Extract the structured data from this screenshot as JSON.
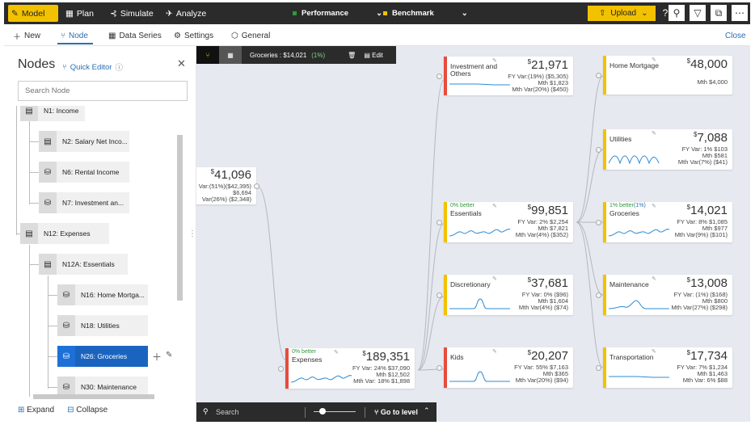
{
  "topbar": {
    "model": "Model",
    "plan": "Plan",
    "simulate": "Simulate",
    "analyze": "Analyze",
    "performance": "Performance",
    "benchmark": "Benchmark",
    "upload": "Upload",
    "perf_color": "#2e9a3a",
    "bench_color": "#f2c200"
  },
  "subbar": {
    "new": "New",
    "node": "Node",
    "data_series": "Data Series",
    "settings": "Settings",
    "general": "General",
    "close": "Close"
  },
  "panel": {
    "title": "Nodes",
    "quick_editor": "Quick Editor",
    "search_placeholder": "Search Node",
    "expand": "Expand",
    "collapse": "Collapse",
    "nodes": [
      {
        "label": "N1: Income"
      },
      {
        "label": "N2: Salary Net Inco..."
      },
      {
        "label": "N6: Rental Income"
      },
      {
        "label": "N7: Investment an..."
      },
      {
        "label": "N12: Expenses"
      },
      {
        "label": "N12A: Essentials"
      },
      {
        "label": "N16: Home Mortga..."
      },
      {
        "label": "N18: Utilities"
      },
      {
        "label": "N26: Groceries"
      },
      {
        "label": "N30: Maintenance"
      }
    ]
  },
  "canvas": {
    "toolbar_label": "Groceries : $14,021",
    "toolbar_change": "(1%)",
    "edit": "Edit",
    "search": "Search",
    "go_to_level": "Go to level",
    "income_card": {
      "value": "41,096",
      "fy": "Var:(51%)($42,395)",
      "mth": "$6,694",
      "mth_var": "Var(26%)  ($2,348)"
    },
    "cards": {
      "investment": {
        "name": "Investment and Others",
        "value": "21,971",
        "r1": "FY Var:(19%)  ($5,305)",
        "r2": "Mth          $1,823",
        "r3": "Mth Var(20%)    ($450)",
        "color": "#e74c3c"
      },
      "essentials": {
        "name": "Essentials",
        "value": "99,851",
        "better": "0% better",
        "r1": "FY Var:    2%   $2,254",
        "r2": "Mth              $7,821",
        "r3": "Mth Var(4%)      ($352)",
        "color": "#f2c200"
      },
      "discretionary": {
        "name": "Discretionary",
        "value": "37,681",
        "r1": "FY Var:    0%     ($96)",
        "r2": "Mth              $1,604",
        "r3": "Mth Var(4%)       ($74)",
        "color": "#f2c200"
      },
      "kids": {
        "name": "Kids",
        "value": "20,207",
        "r1": "FY Var:   55%   $7,163",
        "r2": "Mth                $365",
        "r3": "Mth Var(20%)      ($94)",
        "color": "#e74c3c"
      },
      "expenses": {
        "name": "Expenses",
        "value": "189,351",
        "better": "0% better",
        "r1": "FY Var:  24%  $37,090",
        "r2": "Mth          $12,502",
        "r3": "Mth Var: 18%   $1,898",
        "color": "#e74c3c"
      },
      "mortgage": {
        "name": "Home Mortgage",
        "value": "48,000",
        "r1": "",
        "r2": "Mth             $4,000",
        "r3": "",
        "color": "#f2c200"
      },
      "utilities": {
        "name": "Utilities",
        "value": "7,088",
        "r1": "FY Var:    1%     $103",
        "r2": "Mth                $581",
        "r3": "Mth Var(7%)       ($41)",
        "color": "#f2c200"
      },
      "groceries": {
        "name": "Groceries",
        "value": "14,021",
        "better": "1% better",
        "change": "(1%)",
        "r1": "FY Var:    8%   $1,085",
        "r2": "Mth                $977",
        "r3": "Mth Var(9%)     ($101)",
        "color": "#f2c200"
      },
      "maintenance": {
        "name": "Maintenance",
        "value": "13,008",
        "r1": "FY Var:  (1%)    ($168)",
        "r2": "Mth                $800",
        "r3": "Mth Var(27%)    ($298)",
        "color": "#f2c200"
      },
      "transportation": {
        "name": "Transportation",
        "value": "17,734",
        "r1": "FY Var:    7%   $1,234",
        "r2": "Mth              $1,463",
        "r3": "Mth Var:  6%       $88",
        "color": "#f2c200"
      }
    }
  }
}
